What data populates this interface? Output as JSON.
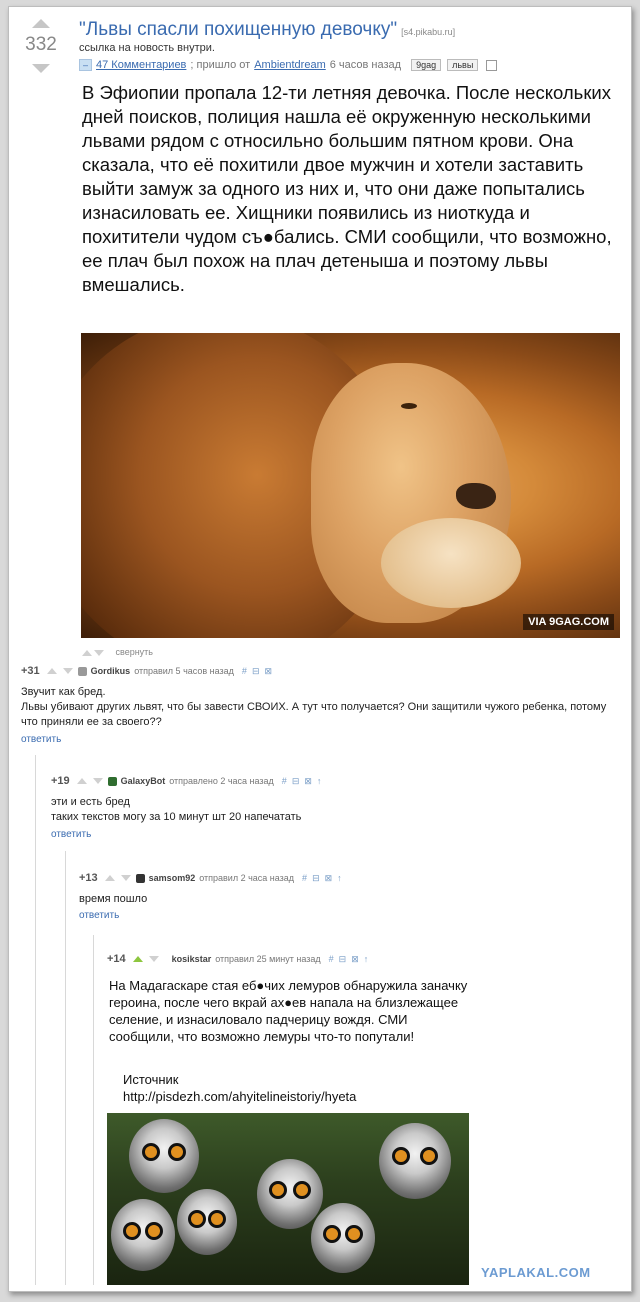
{
  "post": {
    "score": "332",
    "title": "\"Львы спасли похищенную девочку\"",
    "domain": "[s4.pikabu.ru]",
    "subtitle": "ссылка на новость внутри.",
    "badge": "–",
    "comments_link": "47 Комментариев",
    "posted_prefix": "; пришло от",
    "author": "Ambientdream",
    "time": "6 часов назад",
    "tags": [
      "9gag",
      "львы"
    ],
    "body": "В Эфиопии пропала 12-ти летняя девочка. После нескольких дней поисков, полиция нашла её окруженную несколькими львами рядом с относильно большим пятном крови. Она сказала, что её похитили двое мужчин и хотели заставить выйти замуж за одного из них и, что они даже попытались изнасиловать ее. Хищники появились из ниоткуда и похитители чудом съ●бались. СМИ сообщили, что возможно, ее плач был похож на плач детеныша и поэтому львы вмешались.",
    "image_watermark": "VIA 9GAG.COM"
  },
  "collapse_label": "свернуть",
  "comments": [
    {
      "score": "+31",
      "user": "Gordikus",
      "meta": "отправил 5 часов назад",
      "text": "Звучит как бред.\nЛьвы убивают других львят, что бы завести СВОИХ. А тут что получается? Они защитили чужого ребенка, потому что приняли ее за своего??",
      "reply": "ответить"
    },
    {
      "score": "+19",
      "user": "GalaxyBot",
      "meta": "отправлено 2 часа назад",
      "text": "эти и есть бред\nтаких текстов могу за 10 минут шт 20 напечатать",
      "reply": "ответить"
    },
    {
      "score": "+13",
      "user": "samsom92",
      "meta": "отправил 2 часа назад",
      "text": "время пошло",
      "reply": "ответить"
    },
    {
      "score": "+14",
      "user": "kosikstar",
      "meta": "отправил 25 минут назад",
      "text": "На Мадагаскаре стая еб●чих лемуров обнаружила заначку героина, после чего вкрай ах●ев напала на близлежащее селение, и изнасиловало падчерицу вождя. СМИ сообщили, что возможно лемуры что-то попутали!",
      "source_label": "Источник",
      "source_url": "http://pisdezh.com/ahyitelineistoriy/hyeta"
    }
  ],
  "site_watermark": "YAPLAKAL.COM",
  "icons": {
    "tool_1": "#",
    "tool_2": "⊟",
    "tool_3": "⊠",
    "tool_4": "↑"
  }
}
